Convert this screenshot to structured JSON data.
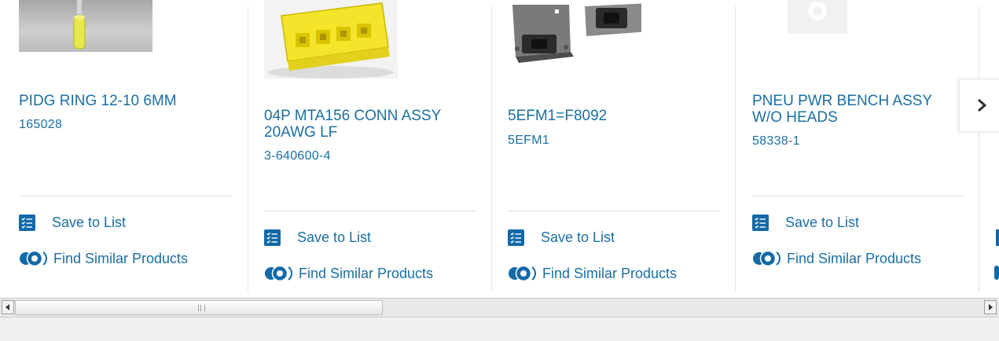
{
  "products": [
    {
      "title": "PIDG RING 12-10 6MM",
      "part_number": "165028"
    },
    {
      "title": "04P MTA156 CONN ASSY 20AWG LF",
      "part_number": "3-640600-4"
    },
    {
      "title": "5EFM1=F8092",
      "part_number": "5EFM1"
    },
    {
      "title": "PNEU PWR BENCH ASSY W/O HEADS",
      "part_number": "58338-1"
    }
  ],
  "actions": {
    "save_to_list": "Save to List",
    "find_similar": "Find Similar Products"
  },
  "colors": {
    "link": "#1a6fa3",
    "icon": "#1269a8"
  }
}
